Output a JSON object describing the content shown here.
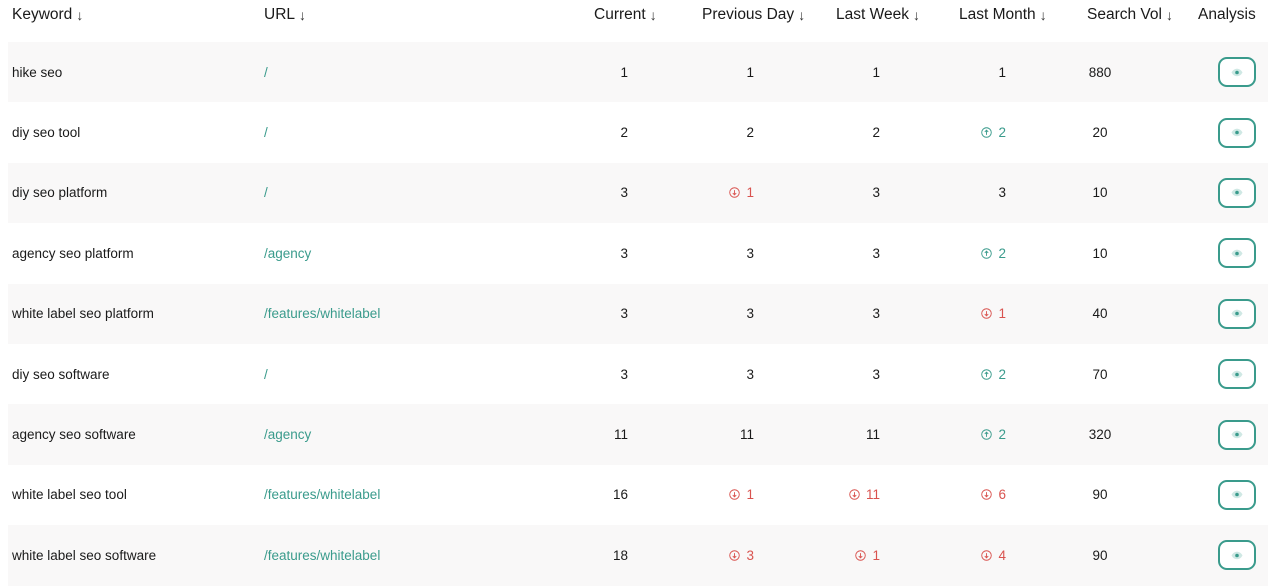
{
  "colors": {
    "accent": "#3a9b8c",
    "down": "#d9534f",
    "up": "#3a9b8c",
    "row_alt": "#f9f8f8"
  },
  "headers": {
    "keyword": "Keyword",
    "url": "URL",
    "current": "Current",
    "previous_day": "Previous Day",
    "last_week": "Last Week",
    "last_month": "Last Month",
    "search_vol": "Search Vol",
    "analysis": "Analysis",
    "sort_icon": "arrow-down-icon"
  },
  "rows": [
    {
      "keyword": "hike seo",
      "url": "/",
      "current": "1",
      "previous_day": {
        "value": "1",
        "dir": "none"
      },
      "last_week": {
        "value": "1",
        "dir": "none"
      },
      "last_month": {
        "value": "1",
        "dir": "none"
      },
      "search_vol": "880"
    },
    {
      "keyword": "diy seo tool",
      "url": "/",
      "current": "2",
      "previous_day": {
        "value": "2",
        "dir": "none"
      },
      "last_week": {
        "value": "2",
        "dir": "none"
      },
      "last_month": {
        "value": "2",
        "dir": "up"
      },
      "search_vol": "20"
    },
    {
      "keyword": "diy seo platform",
      "url": "/",
      "current": "3",
      "previous_day": {
        "value": "1",
        "dir": "down"
      },
      "last_week": {
        "value": "3",
        "dir": "none"
      },
      "last_month": {
        "value": "3",
        "dir": "none"
      },
      "search_vol": "10"
    },
    {
      "keyword": "agency seo platform",
      "url": "/agency",
      "current": "3",
      "previous_day": {
        "value": "3",
        "dir": "none"
      },
      "last_week": {
        "value": "3",
        "dir": "none"
      },
      "last_month": {
        "value": "2",
        "dir": "up"
      },
      "search_vol": "10"
    },
    {
      "keyword": "white label seo platform",
      "url": "/features/whitelabel",
      "current": "3",
      "previous_day": {
        "value": "3",
        "dir": "none"
      },
      "last_week": {
        "value": "3",
        "dir": "none"
      },
      "last_month": {
        "value": "1",
        "dir": "down"
      },
      "search_vol": "40"
    },
    {
      "keyword": "diy seo software",
      "url": "/",
      "current": "3",
      "previous_day": {
        "value": "3",
        "dir": "none"
      },
      "last_week": {
        "value": "3",
        "dir": "none"
      },
      "last_month": {
        "value": "2",
        "dir": "up"
      },
      "search_vol": "70"
    },
    {
      "keyword": "agency seo software",
      "url": "/agency",
      "current": "11",
      "previous_day": {
        "value": "11",
        "dir": "none"
      },
      "last_week": {
        "value": "11",
        "dir": "none"
      },
      "last_month": {
        "value": "2",
        "dir": "up"
      },
      "search_vol": "320"
    },
    {
      "keyword": "white label seo tool",
      "url": "/features/whitelabel",
      "current": "16",
      "previous_day": {
        "value": "1",
        "dir": "down"
      },
      "last_week": {
        "value": "11",
        "dir": "down"
      },
      "last_month": {
        "value": "6",
        "dir": "down"
      },
      "search_vol": "90"
    },
    {
      "keyword": "white label seo software",
      "url": "/features/whitelabel",
      "current": "18",
      "previous_day": {
        "value": "3",
        "dir": "down"
      },
      "last_week": {
        "value": "1",
        "dir": "down"
      },
      "last_month": {
        "value": "4",
        "dir": "down"
      },
      "search_vol": "90"
    }
  ]
}
